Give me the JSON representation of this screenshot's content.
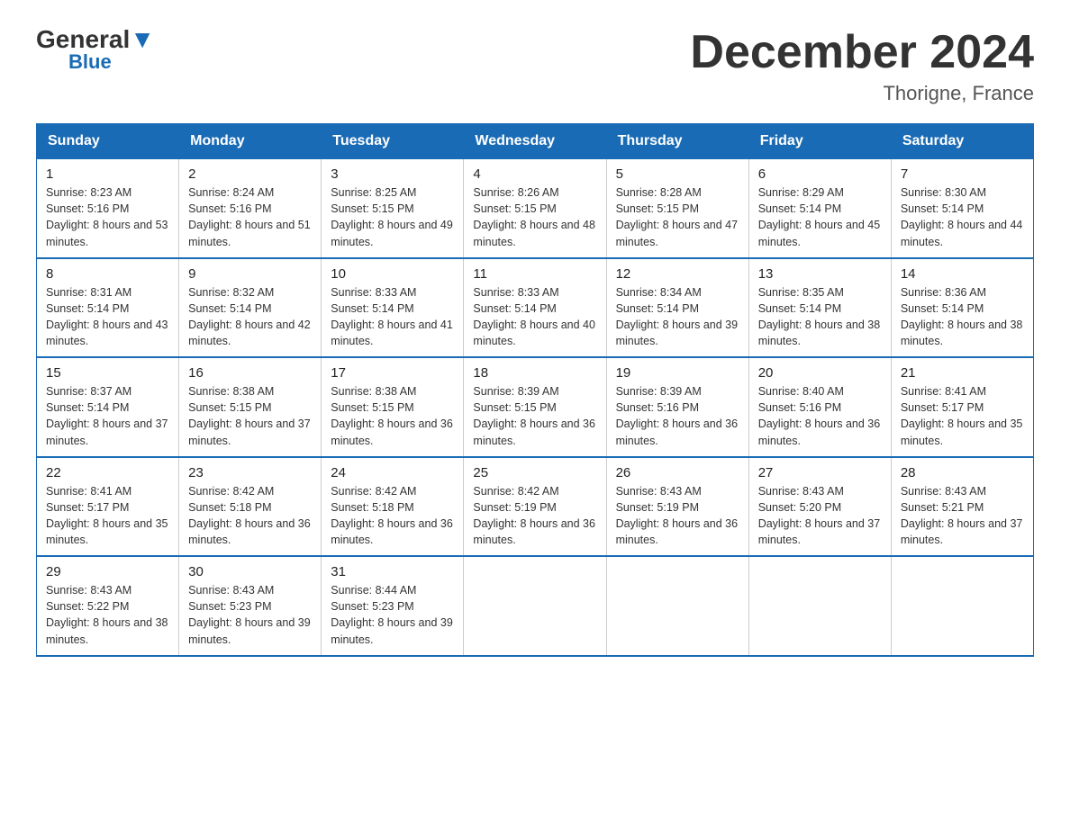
{
  "header": {
    "logo_general": "General",
    "logo_blue": "Blue",
    "month_title": "December 2024",
    "location": "Thorigne, France"
  },
  "weekdays": [
    "Sunday",
    "Monday",
    "Tuesday",
    "Wednesday",
    "Thursday",
    "Friday",
    "Saturday"
  ],
  "weeks": [
    [
      {
        "day": "1",
        "sunrise": "8:23 AM",
        "sunset": "5:16 PM",
        "daylight": "8 hours and 53 minutes."
      },
      {
        "day": "2",
        "sunrise": "8:24 AM",
        "sunset": "5:16 PM",
        "daylight": "8 hours and 51 minutes."
      },
      {
        "day": "3",
        "sunrise": "8:25 AM",
        "sunset": "5:15 PM",
        "daylight": "8 hours and 49 minutes."
      },
      {
        "day": "4",
        "sunrise": "8:26 AM",
        "sunset": "5:15 PM",
        "daylight": "8 hours and 48 minutes."
      },
      {
        "day": "5",
        "sunrise": "8:28 AM",
        "sunset": "5:15 PM",
        "daylight": "8 hours and 47 minutes."
      },
      {
        "day": "6",
        "sunrise": "8:29 AM",
        "sunset": "5:14 PM",
        "daylight": "8 hours and 45 minutes."
      },
      {
        "day": "7",
        "sunrise": "8:30 AM",
        "sunset": "5:14 PM",
        "daylight": "8 hours and 44 minutes."
      }
    ],
    [
      {
        "day": "8",
        "sunrise": "8:31 AM",
        "sunset": "5:14 PM",
        "daylight": "8 hours and 43 minutes."
      },
      {
        "day": "9",
        "sunrise": "8:32 AM",
        "sunset": "5:14 PM",
        "daylight": "8 hours and 42 minutes."
      },
      {
        "day": "10",
        "sunrise": "8:33 AM",
        "sunset": "5:14 PM",
        "daylight": "8 hours and 41 minutes."
      },
      {
        "day": "11",
        "sunrise": "8:33 AM",
        "sunset": "5:14 PM",
        "daylight": "8 hours and 40 minutes."
      },
      {
        "day": "12",
        "sunrise": "8:34 AM",
        "sunset": "5:14 PM",
        "daylight": "8 hours and 39 minutes."
      },
      {
        "day": "13",
        "sunrise": "8:35 AM",
        "sunset": "5:14 PM",
        "daylight": "8 hours and 38 minutes."
      },
      {
        "day": "14",
        "sunrise": "8:36 AM",
        "sunset": "5:14 PM",
        "daylight": "8 hours and 38 minutes."
      }
    ],
    [
      {
        "day": "15",
        "sunrise": "8:37 AM",
        "sunset": "5:14 PM",
        "daylight": "8 hours and 37 minutes."
      },
      {
        "day": "16",
        "sunrise": "8:38 AM",
        "sunset": "5:15 PM",
        "daylight": "8 hours and 37 minutes."
      },
      {
        "day": "17",
        "sunrise": "8:38 AM",
        "sunset": "5:15 PM",
        "daylight": "8 hours and 36 minutes."
      },
      {
        "day": "18",
        "sunrise": "8:39 AM",
        "sunset": "5:15 PM",
        "daylight": "8 hours and 36 minutes."
      },
      {
        "day": "19",
        "sunrise": "8:39 AM",
        "sunset": "5:16 PM",
        "daylight": "8 hours and 36 minutes."
      },
      {
        "day": "20",
        "sunrise": "8:40 AM",
        "sunset": "5:16 PM",
        "daylight": "8 hours and 36 minutes."
      },
      {
        "day": "21",
        "sunrise": "8:41 AM",
        "sunset": "5:17 PM",
        "daylight": "8 hours and 35 minutes."
      }
    ],
    [
      {
        "day": "22",
        "sunrise": "8:41 AM",
        "sunset": "5:17 PM",
        "daylight": "8 hours and 35 minutes."
      },
      {
        "day": "23",
        "sunrise": "8:42 AM",
        "sunset": "5:18 PM",
        "daylight": "8 hours and 36 minutes."
      },
      {
        "day": "24",
        "sunrise": "8:42 AM",
        "sunset": "5:18 PM",
        "daylight": "8 hours and 36 minutes."
      },
      {
        "day": "25",
        "sunrise": "8:42 AM",
        "sunset": "5:19 PM",
        "daylight": "8 hours and 36 minutes."
      },
      {
        "day": "26",
        "sunrise": "8:43 AM",
        "sunset": "5:19 PM",
        "daylight": "8 hours and 36 minutes."
      },
      {
        "day": "27",
        "sunrise": "8:43 AM",
        "sunset": "5:20 PM",
        "daylight": "8 hours and 37 minutes."
      },
      {
        "day": "28",
        "sunrise": "8:43 AM",
        "sunset": "5:21 PM",
        "daylight": "8 hours and 37 minutes."
      }
    ],
    [
      {
        "day": "29",
        "sunrise": "8:43 AM",
        "sunset": "5:22 PM",
        "daylight": "8 hours and 38 minutes."
      },
      {
        "day": "30",
        "sunrise": "8:43 AM",
        "sunset": "5:23 PM",
        "daylight": "8 hours and 39 minutes."
      },
      {
        "day": "31",
        "sunrise": "8:44 AM",
        "sunset": "5:23 PM",
        "daylight": "8 hours and 39 minutes."
      },
      null,
      null,
      null,
      null
    ]
  ]
}
